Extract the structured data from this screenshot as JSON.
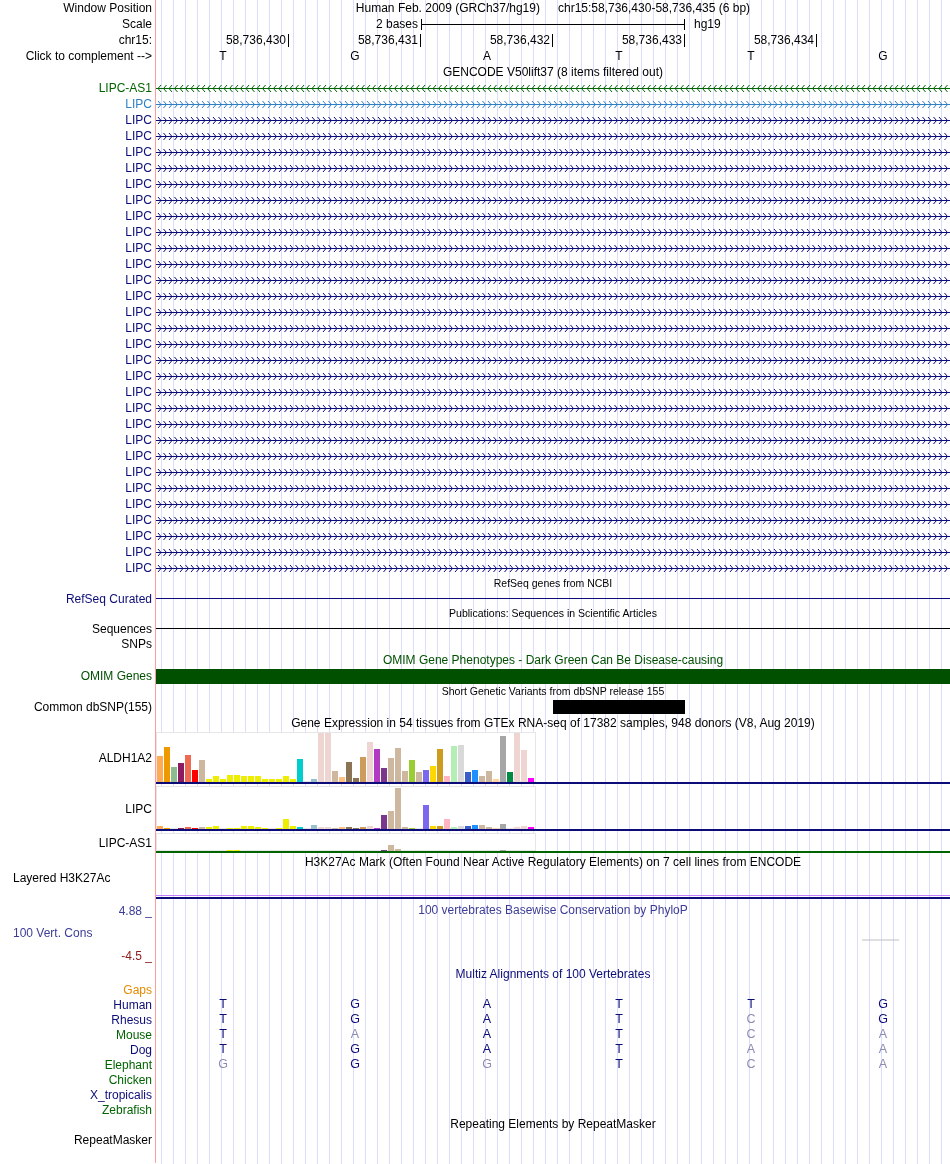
{
  "header": {
    "window_position_label": "Window Position",
    "assembly": "Human Feb. 2009 (GRCh37/hg19)",
    "position": "chr15:58,736,430-58,736,435 (6 bp)",
    "scale_label": "Scale",
    "scale_text": "2 bases",
    "scale_db": "hg19",
    "chrom_label": "chr15:",
    "position_labels": [
      "58,736,430",
      "58,736,431",
      "58,736,432",
      "58,736,433",
      "58,736,434"
    ],
    "complement_label": "Click to complement -->",
    "bases": [
      "T",
      "G",
      "A",
      "T",
      "T",
      "G"
    ]
  },
  "tracks": [
    {
      "kind": "genes",
      "title": "GENCODE V50lift37 (8 items filtered out)",
      "items": [
        {
          "name": "LIPC-AS1",
          "color": "#006400",
          "reverse": true
        },
        {
          "name": "LIPC",
          "color": "#2f7fc4",
          "reverse": false
        },
        {
          "name": "LIPC",
          "color": "#0c0c78",
          "reverse": false
        },
        {
          "name": "LIPC",
          "color": "#0c0c78",
          "reverse": false
        },
        {
          "name": "LIPC",
          "color": "#0c0c78",
          "reverse": false
        },
        {
          "name": "LIPC",
          "color": "#0c0c78",
          "reverse": false
        },
        {
          "name": "LIPC",
          "color": "#0c0c78",
          "reverse": false
        },
        {
          "name": "LIPC",
          "color": "#0c0c78",
          "reverse": false
        },
        {
          "name": "LIPC",
          "color": "#0c0c78",
          "reverse": false
        },
        {
          "name": "LIPC",
          "color": "#0c0c78",
          "reverse": false
        },
        {
          "name": "LIPC",
          "color": "#0c0c78",
          "reverse": false
        },
        {
          "name": "LIPC",
          "color": "#0c0c78",
          "reverse": false
        },
        {
          "name": "LIPC",
          "color": "#0c0c78",
          "reverse": false
        },
        {
          "name": "LIPC",
          "color": "#0c0c78",
          "reverse": false
        },
        {
          "name": "LIPC",
          "color": "#0c0c78",
          "reverse": false
        },
        {
          "name": "LIPC",
          "color": "#0c0c78",
          "reverse": false
        },
        {
          "name": "LIPC",
          "color": "#0c0c78",
          "reverse": false
        },
        {
          "name": "LIPC",
          "color": "#0c0c78",
          "reverse": false
        },
        {
          "name": "LIPC",
          "color": "#0c0c78",
          "reverse": false
        },
        {
          "name": "LIPC",
          "color": "#0c0c78",
          "reverse": false
        },
        {
          "name": "LIPC",
          "color": "#0c0c78",
          "reverse": false
        },
        {
          "name": "LIPC",
          "color": "#0c0c78",
          "reverse": false
        },
        {
          "name": "LIPC",
          "color": "#0c0c78",
          "reverse": false
        },
        {
          "name": "LIPC",
          "color": "#0c0c78",
          "reverse": false
        },
        {
          "name": "LIPC",
          "color": "#0c0c78",
          "reverse": false
        },
        {
          "name": "LIPC",
          "color": "#0c0c78",
          "reverse": false
        },
        {
          "name": "LIPC",
          "color": "#0c0c78",
          "reverse": false
        },
        {
          "name": "LIPC",
          "color": "#0c0c78",
          "reverse": false
        },
        {
          "name": "LIPC",
          "color": "#0c0c78",
          "reverse": false
        },
        {
          "name": "LIPC",
          "color": "#0c0c78",
          "reverse": false
        },
        {
          "name": "LIPC",
          "color": "#0c0c78",
          "reverse": false
        }
      ]
    },
    {
      "kind": "dense-line",
      "title": "RefSeq genes from NCBI",
      "label": "RefSeq Curated",
      "color": "#0c0c78"
    },
    {
      "kind": "dense-line",
      "title": "Publications: Sequences in Scientific Articles",
      "label": "Sequences",
      "color": "#000000"
    },
    {
      "kind": "empty",
      "label": "SNPs"
    },
    {
      "kind": "bar",
      "title": "OMIM Gene Phenotypes - Dark Green Can Be Disease-causing",
      "label": "OMIM Genes",
      "color": "#005000"
    },
    {
      "kind": "dense-block",
      "title": "Short Genetic Variants from dbSNP release 155",
      "label": "Common dbSNP(155)",
      "covered": [
        false,
        false,
        false,
        true,
        false,
        false
      ]
    },
    {
      "kind": "gtex",
      "title": "Gene Expression in 54 tissues from GTEx RNA-seq of 17382 samples, 948 donors (V8, Aug 2019)",
      "rows": [
        {
          "name": "ALDH1A2",
          "color": "#0c0c78"
        },
        {
          "name": "LIPC",
          "color": "#0c0c78"
        },
        {
          "name": "LIPC-AS1",
          "color": "#006400"
        }
      ]
    },
    {
      "kind": "signal",
      "title": "H3K27Ac Mark (Often Found Near Active Regulatory Elements) on 7 cell lines from ENCODE",
      "label": "Layered H3K27Ac"
    },
    {
      "kind": "phylop",
      "title": "100 vertebrates Basewise Conservation by PhyloP",
      "label": "100 Vert. Cons",
      "max_label": "4.88 _",
      "min_label": "-4.5 _",
      "color": "#3c3c96"
    },
    {
      "kind": "multiz",
      "title": "Multiz Alignments of 100 Vertebrates",
      "rows": [
        {
          "kind": "gaps",
          "name": "Gaps",
          "color": "#e68a00"
        },
        {
          "kind": "species",
          "name": "Human",
          "color": "#0c0c78",
          "bases": [
            {
              "base": "T",
              "match": true
            },
            {
              "base": "G",
              "match": true
            },
            {
              "base": "A",
              "match": true
            },
            {
              "base": "T",
              "match": true
            },
            {
              "base": "T",
              "match": true
            },
            {
              "base": "G",
              "match": true
            }
          ]
        },
        {
          "kind": "species",
          "name": "Rhesus",
          "color": "#0c0c78",
          "bases": [
            {
              "base": "T",
              "match": true
            },
            {
              "base": "G",
              "match": true
            },
            {
              "base": "A",
              "match": true
            },
            {
              "base": "T",
              "match": true
            },
            {
              "base": "C",
              "match": false
            },
            {
              "base": "G",
              "match": true
            }
          ]
        },
        {
          "kind": "species",
          "name": "Mouse",
          "color": "#006400",
          "bases": [
            {
              "base": "T",
              "match": true
            },
            {
              "base": "A",
              "match": false
            },
            {
              "base": "A",
              "match": true
            },
            {
              "base": "T",
              "match": true
            },
            {
              "base": "C",
              "match": false
            },
            {
              "base": "A",
              "match": false
            }
          ]
        },
        {
          "kind": "species",
          "name": "Dog",
          "color": "#0c0c78",
          "bases": [
            {
              "base": "T",
              "match": true
            },
            {
              "base": "G",
              "match": true
            },
            {
              "base": "A",
              "match": true
            },
            {
              "base": "T",
              "match": true
            },
            {
              "base": "A",
              "match": false
            },
            {
              "base": "A",
              "match": false
            }
          ]
        },
        {
          "kind": "species",
          "name": "Elephant",
          "color": "#006400",
          "bases": [
            {
              "base": "G",
              "match": false
            },
            {
              "base": "G",
              "match": true
            },
            {
              "base": "G",
              "match": false
            },
            {
              "base": "T",
              "match": true
            },
            {
              "base": "C",
              "match": false
            },
            {
              "base": "A",
              "match": false
            }
          ]
        },
        {
          "kind": "species",
          "name": "Chicken",
          "color": "#006400"
        },
        {
          "kind": "species",
          "name": "X_tropicalis",
          "color": "#0c0c78"
        },
        {
          "kind": "species",
          "name": "Zebrafish",
          "color": "#006400"
        }
      ]
    },
    {
      "kind": "repeat",
      "title": "Repeating Elements by RepeatMasker",
      "label": "RepeatMasker"
    }
  ]
}
